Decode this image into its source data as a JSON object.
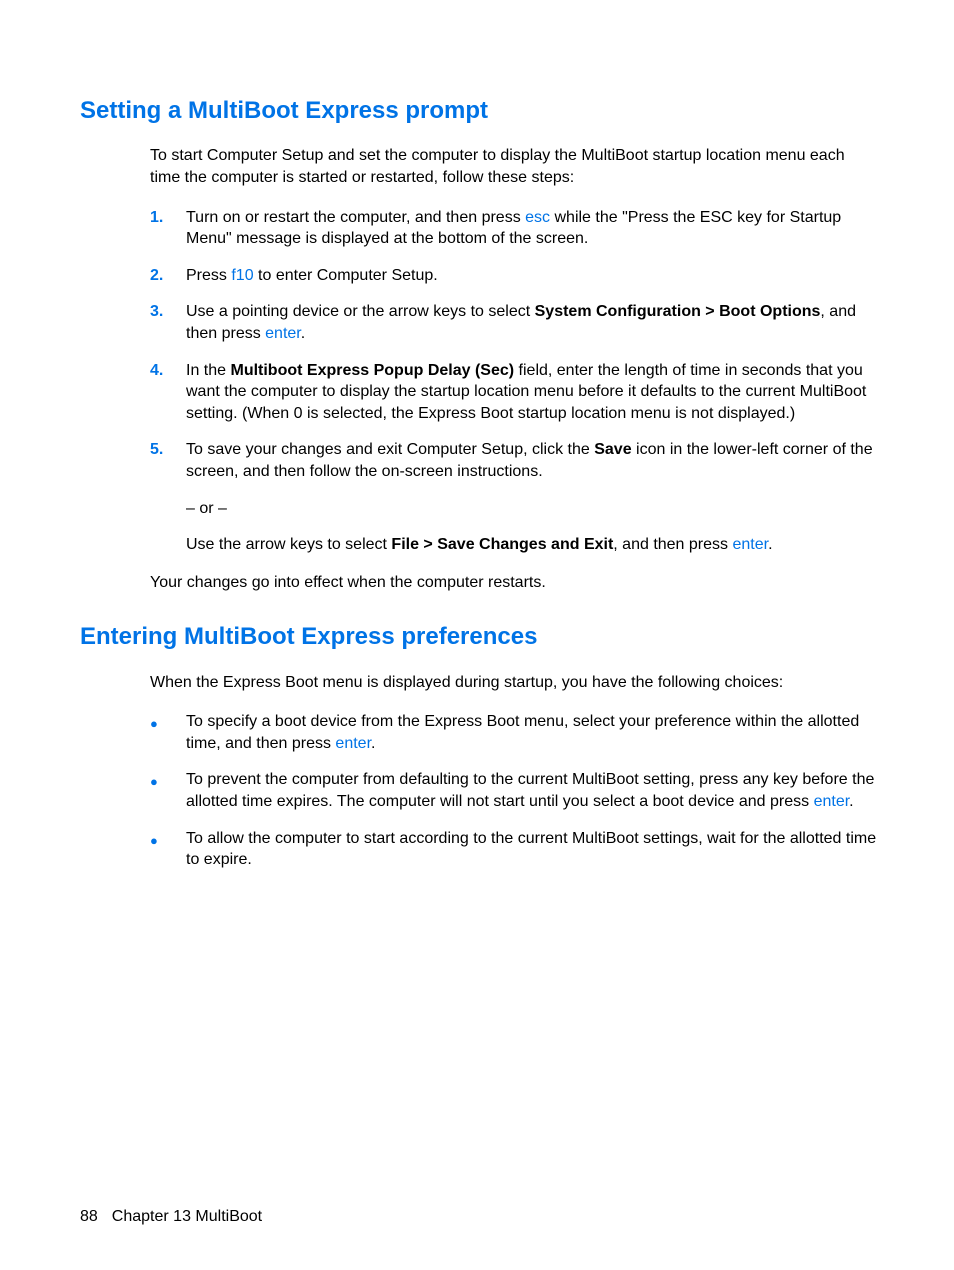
{
  "section1": {
    "heading": "Setting a MultiBoot Express prompt",
    "intro": "To start Computer Setup and set the computer to display the MultiBoot startup location menu each time the computer is started or restarted, follow these steps:",
    "steps": [
      {
        "num": "1.",
        "pre": "Turn on or restart the computer, and then press ",
        "key": "esc",
        "post": " while the \"Press the ESC key for Startup Menu\" message is displayed at the bottom of the screen."
      },
      {
        "num": "2.",
        "pre": "Press ",
        "key": "f10",
        "post": " to enter Computer Setup."
      },
      {
        "num": "3.",
        "pre": "Use a pointing device or the arrow keys to select ",
        "bold": "System Configuration > Boot Options",
        "mid": ", and then press ",
        "key": "enter",
        "post": "."
      },
      {
        "num": "4.",
        "pre": "In the ",
        "bold": "Multiboot Express Popup Delay (Sec)",
        "post": " field, enter the length of time in seconds that you want the computer to display the startup location menu before it defaults to the current MultiBoot setting. (When 0 is selected, the Express Boot startup location menu is not displayed.)"
      },
      {
        "num": "5.",
        "pre": "To save your changes and exit Computer Setup, click the ",
        "bold": "Save",
        "post": " icon in the lower-left corner of the screen, and then follow the on-screen instructions.",
        "or": "– or –",
        "alt_pre": "Use the arrow keys to select ",
        "alt_bold": "File > Save Changes and Exit",
        "alt_mid": ", and then press ",
        "alt_key": "enter",
        "alt_post": "."
      }
    ],
    "conclusion": "Your changes go into effect when the computer restarts."
  },
  "section2": {
    "heading": "Entering MultiBoot Express preferences",
    "intro": "When the Express Boot menu is displayed during startup, you have the following choices:",
    "bullets": [
      {
        "pre": "To specify a boot device from the Express Boot menu, select your preference within the allotted time, and then press ",
        "key": "enter",
        "post": "."
      },
      {
        "pre": "To prevent the computer from defaulting to the current MultiBoot setting, press any key before the allotted time expires. The computer will not start until you select a boot device and press ",
        "key": "enter",
        "post": "."
      },
      {
        "pre": "To allow the computer to start according to the current MultiBoot settings, wait for the allotted time to expire.",
        "key": "",
        "post": ""
      }
    ]
  },
  "footer": {
    "page": "88",
    "chapter": "Chapter 13    MultiBoot"
  }
}
